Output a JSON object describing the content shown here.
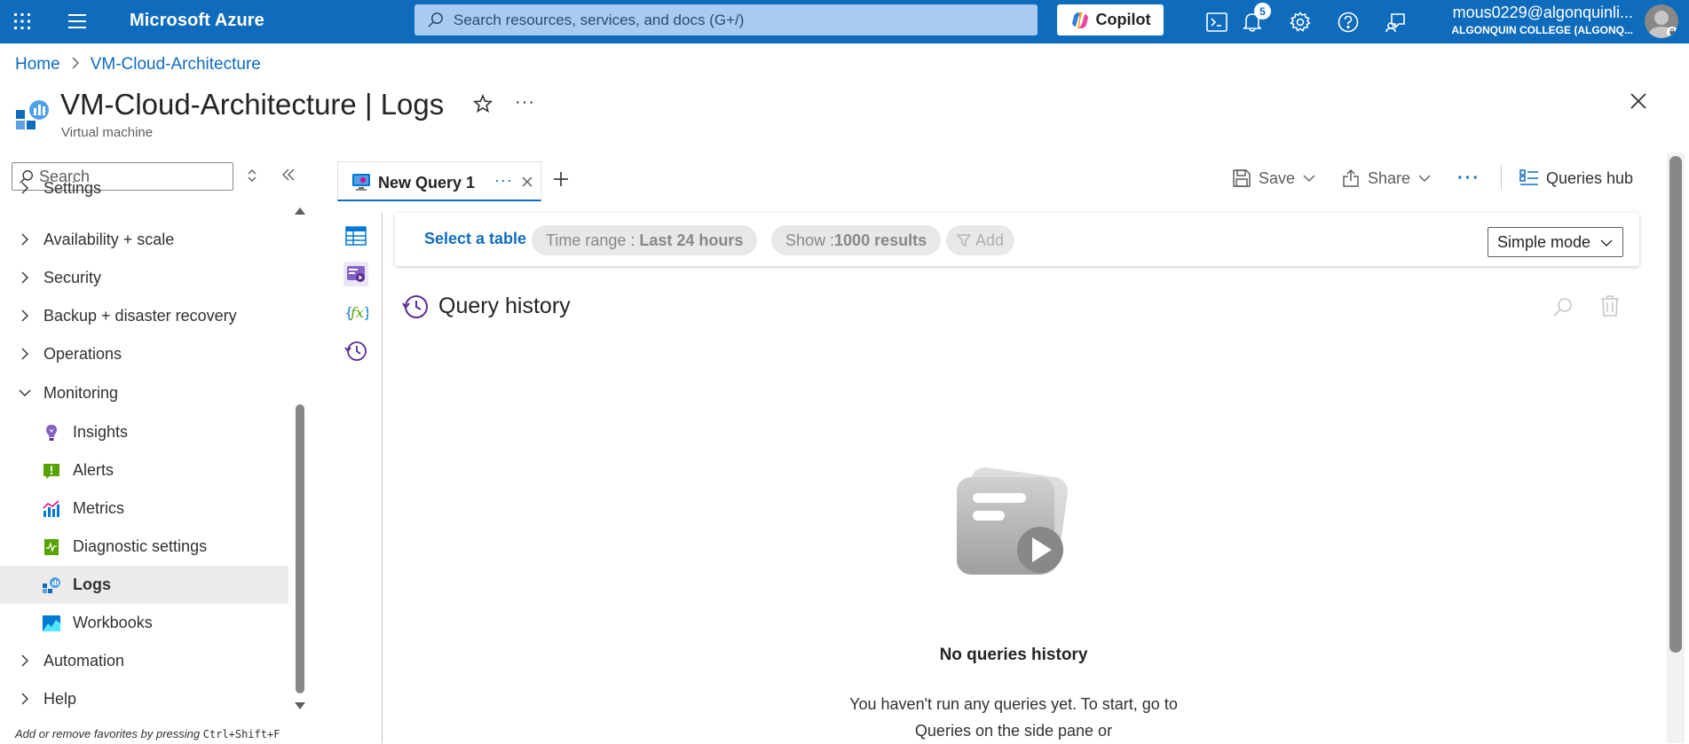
{
  "topbar": {
    "brand": "Microsoft Azure",
    "search_placeholder": "Search resources, services, and docs (G+/)",
    "copilot_label": "Copilot",
    "notification_count": "5",
    "user_email": "mous0229@algonquinli...",
    "user_org": "ALGONQUIN COLLEGE (ALGONQ..."
  },
  "breadcrumb": {
    "items": [
      "Home",
      "VM-Cloud-Architecture"
    ]
  },
  "header": {
    "title": "VM-Cloud-Architecture",
    "separator": "|",
    "section": "Logs",
    "subtitle": "Virtual machine",
    "more_label": "···"
  },
  "sidebar": {
    "search_placeholder": "Search",
    "items": [
      {
        "label": "Settings",
        "type": "group",
        "expanded": false
      },
      {
        "label": "Availability + scale",
        "type": "group",
        "expanded": false
      },
      {
        "label": "Security",
        "type": "group",
        "expanded": false
      },
      {
        "label": "Backup + disaster recovery",
        "type": "group",
        "expanded": false
      },
      {
        "label": "Operations",
        "type": "group",
        "expanded": false
      },
      {
        "label": "Monitoring",
        "type": "group",
        "expanded": true
      },
      {
        "label": "Insights",
        "type": "child",
        "icon": "lightbulb-icon"
      },
      {
        "label": "Alerts",
        "type": "child",
        "icon": "alert-icon"
      },
      {
        "label": "Metrics",
        "type": "child",
        "icon": "metrics-icon"
      },
      {
        "label": "Diagnostic settings",
        "type": "child",
        "icon": "diagnostic-icon"
      },
      {
        "label": "Logs",
        "type": "child",
        "icon": "logs-icon",
        "active": true
      },
      {
        "label": "Workbooks",
        "type": "child",
        "icon": "workbooks-icon"
      },
      {
        "label": "Automation",
        "type": "group",
        "expanded": false
      },
      {
        "label": "Help",
        "type": "group",
        "expanded": false
      }
    ],
    "footer_text": "Add or remove favorites by pressing ",
    "footer_shortcut": "Ctrl+Shift+F"
  },
  "query_tab": {
    "label": "New Query 1",
    "more_label": "···"
  },
  "toolbar": {
    "save_label": "Save",
    "share_label": "Share",
    "more_label": "···",
    "queries_hub_label": "Queries hub"
  },
  "query_bar": {
    "select_table": "Select a table",
    "time_range_label": "Time range : ",
    "time_range_value": "Last 24 hours",
    "show_label": "Show : ",
    "show_value": "1000 results",
    "add_label": "Add",
    "mode": "Simple mode"
  },
  "query_history": {
    "title": "Query history",
    "empty_title": "No queries history",
    "empty_text": "You haven't run any queries yet. To start, go to Queries on the side pane or"
  },
  "colors": {
    "brand_blue": "#0f6cbd",
    "active_item_bg": "#edebe9"
  }
}
